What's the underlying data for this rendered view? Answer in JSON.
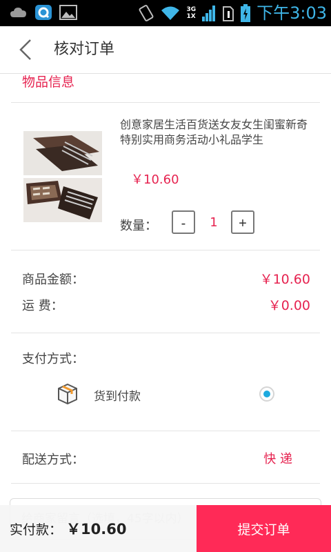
{
  "status_bar": {
    "time": "下午3:03",
    "network_top": "3G",
    "network_bottom": "1X"
  },
  "header": {
    "title": "核对订单"
  },
  "section": {
    "title": "物品信息"
  },
  "product": {
    "name": "创意家居生活百货送女友女生闺蜜新奇特别实用商务活动小礼品学生",
    "price": "￥10.60",
    "quantity_label": "数量：",
    "decrement_label": "-",
    "increment_label": "+",
    "quantity": "1"
  },
  "summary": {
    "amount_label": "商品金额：",
    "amount_value": "￥10.60",
    "shipping_label": "运 费：",
    "shipping_value": "￥0.00"
  },
  "payment": {
    "label": "支付方式：",
    "option": "货到付款",
    "selected": true
  },
  "delivery": {
    "label": "配送方式：",
    "value": "快 递"
  },
  "remark": {
    "placeholder": "给商家留言（选填，45字以内）"
  },
  "footer": {
    "total_label": "实付款：",
    "total_value": "￥10.60",
    "submit_label": "提交订单"
  },
  "colors": {
    "accent": "#e62350",
    "submit_button": "#ff2a57",
    "radio": "#1eaadf",
    "status_time": "#3fb6e8"
  },
  "icons": [
    "cloud-icon",
    "app-q-icon",
    "gallery-icon",
    "rotate-icon",
    "wifi-icon",
    "signal-icon",
    "sim-icon",
    "battery-icon",
    "chevron-left-icon",
    "package-icon"
  ]
}
